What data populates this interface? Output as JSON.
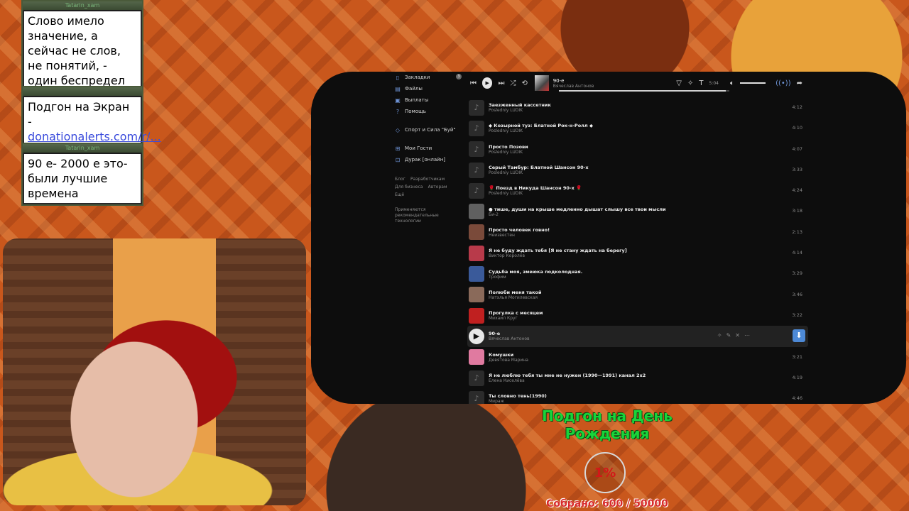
{
  "chat": [
    {
      "user": "Tatarin_xam",
      "text": "Слово имело значение, а сейчас не слов, не понятий, - один беспредел"
    },
    {
      "user": "",
      "text": "Подгон на Экран - ",
      "link": "donationalerts.com/r/..."
    },
    {
      "user": "Tatarin_xam",
      "text": "90 е- 2000 е это- были лучшие времена"
    }
  ],
  "sidebar": {
    "items": [
      {
        "icon": "bookmark-icon",
        "label": "Закладки",
        "badge": "3"
      },
      {
        "icon": "files-icon",
        "label": "Файлы"
      },
      {
        "icon": "payouts-icon",
        "label": "Выплаты"
      },
      {
        "icon": "help-icon",
        "label": "Помощь"
      },
      {
        "icon": "app-icon",
        "label": "Спорт и Сила \"Буй\""
      },
      {
        "icon": "games-icon",
        "label": "Мои Гости"
      },
      {
        "icon": "game-icon",
        "label": "Дурак [онлайн]"
      }
    ],
    "footer": {
      "links": [
        "Блог",
        "Разработчикам",
        "Для бизнеса",
        "Авторам",
        "Ещё"
      ],
      "note": "Применяются рекомендательные технологии"
    }
  },
  "player": {
    "now_title": "90-е",
    "now_artist": "Вячеслав Антонов",
    "time": "5:04",
    "progress": 0.98
  },
  "tracks": [
    {
      "title": "Заезженный кассетник",
      "artist": "Posledniy LUDIK",
      "duration": "4:12",
      "thumb": "note"
    },
    {
      "title": "◆ Козырной туз: Блатной Рок-н-Ролл ◆",
      "artist": "Posledniy LUDIK",
      "duration": "4:10",
      "thumb": "note"
    },
    {
      "title": "Просто Позови",
      "artist": "Posledniy LUDIK",
      "duration": "4:07",
      "thumb": "note"
    },
    {
      "title": "Серый Тамбур: Блатной Шансон 90-х",
      "artist": "Posledniy LUDIK",
      "duration": "3:33",
      "thumb": "note"
    },
    {
      "title": "🌹 Поезд в Никуда Шансон 90-х 🌹",
      "artist": "Posledniy LUDIK",
      "duration": "4:24",
      "thumb": "note"
    },
    {
      "title": "● тише, души на крыше медленно дышат слышу все твои мысли",
      "artist": "Би-2",
      "duration": "3:18",
      "thumb": "img",
      "color": "#606060"
    },
    {
      "title": "Просто человек говно!",
      "artist": "Неизвестен",
      "duration": "2:13",
      "thumb": "img",
      "color": "#7a4a3a"
    },
    {
      "title": "Я не буду ждать тебя [Я не стану ждать на берегу]",
      "artist": "Виктор Королёв",
      "duration": "4:14",
      "thumb": "img",
      "color": "#b83a4a"
    },
    {
      "title": "Судьба моя, змеюка подколодная.",
      "artist": "Трофим",
      "duration": "3:29",
      "thumb": "img",
      "color": "#3a5a9a"
    },
    {
      "title": "Полюби меня такой",
      "artist": "Натэлья Могилевская",
      "duration": "3:46",
      "thumb": "img",
      "color": "#8a6a5a"
    },
    {
      "title": "Прогулка с месяцем",
      "artist": "Михаил Круг",
      "duration": "3:22",
      "thumb": "img",
      "color": "#c02020"
    },
    {
      "title": "90-е",
      "artist": "Вячеслав Антонов",
      "duration": "",
      "thumb": "play",
      "active": true
    },
    {
      "title": "Комушки",
      "artist": "Девятова Марина",
      "duration": "3:21",
      "thumb": "img",
      "color": "#e07aa0"
    },
    {
      "title": "Я не люблю тебя ты мне не нужен (1990—1991) канал 2х2",
      "artist": "Елена Киселёва",
      "duration": "4:19",
      "thumb": "note"
    },
    {
      "title": "Ты словно тень(1990)",
      "artist": "Мираж",
      "duration": "4:46",
      "thumb": "note"
    }
  ],
  "donation": {
    "title": "Подгон на День Рождения",
    "percent": "1%",
    "collected": "Собрано: 600 / 50000"
  }
}
